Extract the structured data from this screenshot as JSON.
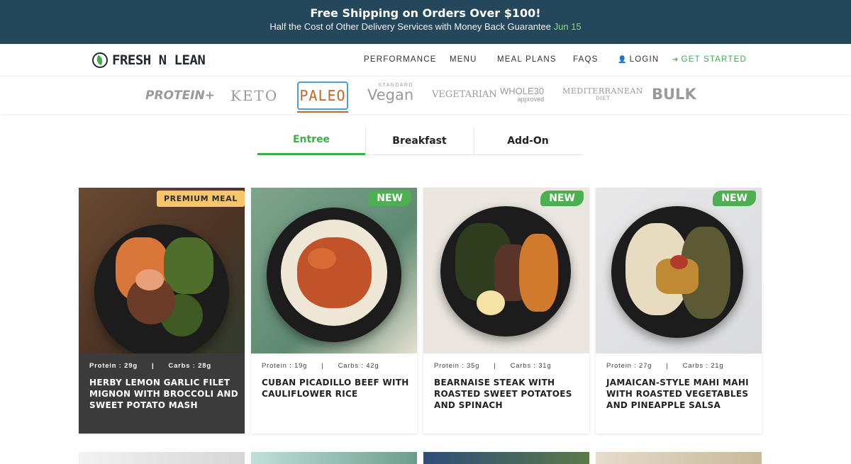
{
  "promo": {
    "headline": "Free Shipping on Orders Over $100!",
    "sub": "Half the Cost of Other Delivery Services with Money Back Guarantee",
    "date": "Jun 15"
  },
  "header": {
    "logo_text": "FRESH N LEAN",
    "nav": [
      {
        "label": "PERFORMANCE"
      },
      {
        "label": "MENU"
      },
      {
        "label": "MEAL PLANS"
      },
      {
        "label": "FAQS"
      },
      {
        "label": "LOGIN",
        "icon": "user-icon"
      },
      {
        "label": "GET STARTED",
        "icon": "leaf-icon"
      }
    ]
  },
  "diets": {
    "protein": "PROTEIN+",
    "keto": "KETO",
    "paleo": "PALEO",
    "vegan_small": "STANDARD",
    "vegan": "Vegan",
    "vegetarian": "VEGETARIAN",
    "whole30": "WHOLE30",
    "whole30_small": "approved",
    "mediterranean": "MEDITERRANEAN",
    "mediterranean_small": "DIET",
    "bulk": "BULK",
    "selected": "PALEO"
  },
  "tabs": [
    {
      "label": "Entree",
      "active": true
    },
    {
      "label": "Breakfast",
      "active": false
    },
    {
      "label": "Add-On",
      "active": false
    }
  ],
  "cards": [
    {
      "badge": "PREMIUM MEAL",
      "protein": "Protein : 29g",
      "carbs": "Carbs : 28g",
      "title": "HERBY LEMON GARLIC FILET MIGNON WITH BROCCOLI AND SWEET POTATO MASH"
    },
    {
      "badge": "NEW",
      "protein": "Protein : 19g",
      "carbs": "Carbs : 42g",
      "title": "CUBAN PICADILLO BEEF WITH CAULIFLOWER RICE"
    },
    {
      "badge": "NEW",
      "protein": "Protein : 35g",
      "carbs": "Carbs : 31g",
      "title": "BEARNAISE STEAK WITH ROASTED SWEET POTATOES AND SPINACH"
    },
    {
      "badge": "NEW",
      "protein": "Protein : 27g",
      "carbs": "Carbs : 21g",
      "title": "JAMAICAN-STYLE MAHI MAHI WITH ROASTED VEGETABLES AND PINEAPPLE SALSA"
    }
  ],
  "macro_separator": "|",
  "colors": {
    "promo_bg": "#25475c",
    "accent_green": "#3fae49",
    "badge_green": "#4caf50",
    "premium_badge": "#f7c66b",
    "paleo_border": "#4a9fd8",
    "paleo_text": "#c5672b"
  }
}
